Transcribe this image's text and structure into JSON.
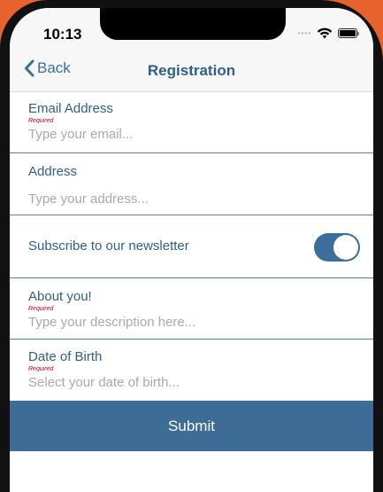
{
  "status_bar": {
    "time": "10:13"
  },
  "navbar": {
    "back_label": "Back",
    "title": "Registration"
  },
  "form": {
    "email": {
      "label": "Email Address",
      "required": "Required",
      "placeholder": "Type your email..."
    },
    "address": {
      "label": "Address",
      "placeholder": "Type your address..."
    },
    "newsletter": {
      "label": "Subscribe to our newsletter",
      "enabled": true
    },
    "about": {
      "label": "About you!",
      "required": "Required",
      "placeholder": "Type your description here..."
    },
    "dob": {
      "label": "Date of Birth",
      "required": "Required",
      "placeholder": "Select your date of birth..."
    },
    "submit_label": "Submit"
  },
  "colors": {
    "accent": "#3b6f9a",
    "submit_bg": "#3d6d96",
    "required": "#d0021b",
    "placeholder": "#a9a9a9"
  }
}
